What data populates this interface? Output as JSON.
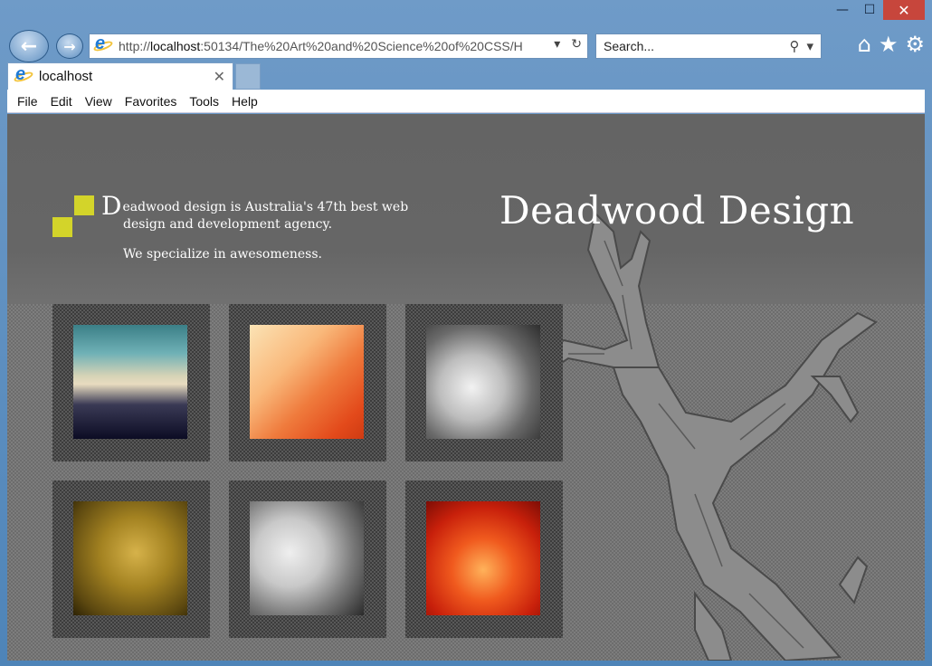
{
  "browser": {
    "window_controls": {
      "minimize": "—",
      "maximize": "☐",
      "close": "✕"
    },
    "address": {
      "url_prefix": "http://",
      "url_host": "localhost",
      "url_rest": ":50134/The%20Art%20and%20Science%20of%20CSS/H"
    },
    "search": {
      "placeholder": "Search..."
    },
    "tab": {
      "title": "localhost"
    },
    "menu": [
      "File",
      "Edit",
      "View",
      "Favorites",
      "Tools",
      "Help"
    ],
    "icons": [
      "back-arrow-icon",
      "forward-arrow-icon",
      "refresh-icon",
      "search-icon",
      "home-icon",
      "favorites-star-icon",
      "settings-gear-icon"
    ]
  },
  "page": {
    "title": "Deadwood Design",
    "intro_dropcap": "D",
    "intro_line1": "eadwood design is Australia's 47th best web",
    "intro_line2": "design and development agency.",
    "tagline": "We specialize in awesomeness.",
    "accent_color": "#d3d42a",
    "gallery": [
      "sunset-landscape-photo",
      "orange-fabric-photo",
      "cat-face-photo",
      "gold-sequin-photo",
      "man-with-bottle-photo",
      "red-flower-photo"
    ]
  }
}
